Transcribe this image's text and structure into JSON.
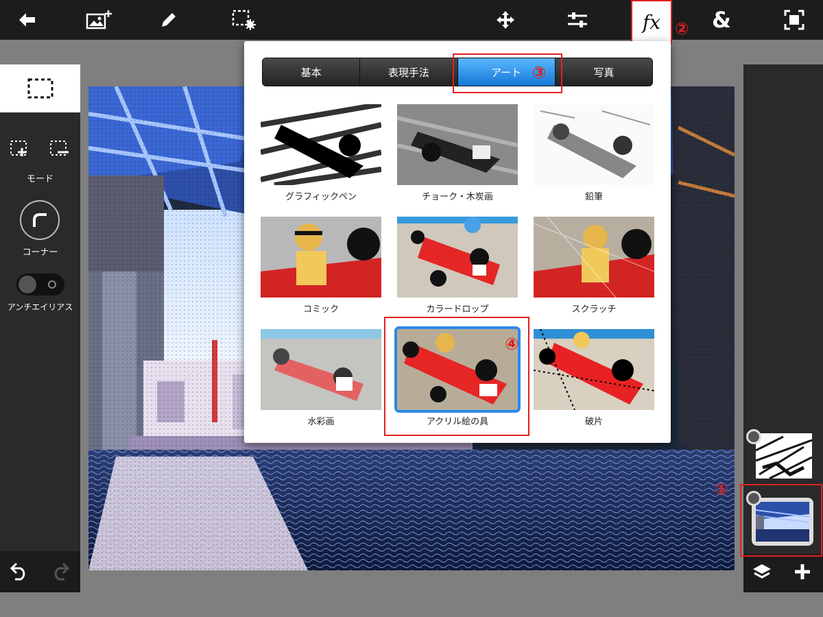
{
  "toolbar": {
    "items": [
      {
        "name": "back-button",
        "icon": "arrow-left-icon"
      },
      {
        "name": "add-image-button",
        "icon": "image-plus-icon"
      },
      {
        "name": "pencil-button",
        "icon": "pencil-icon"
      },
      {
        "name": "selection-settings-button",
        "icon": "selection-gear-icon"
      },
      {
        "name": "move-button",
        "icon": "move-arrows-icon"
      },
      {
        "name": "adjustments-button",
        "icon": "sliders-icon"
      },
      {
        "name": "effects-button",
        "icon": "fx-icon",
        "label": "fx"
      },
      {
        "name": "blend-button",
        "icon": "ampersand-icon",
        "label": "&"
      },
      {
        "name": "fit-screen-button",
        "icon": "fit-screen-icon"
      }
    ]
  },
  "left_panel": {
    "mode_label": "モード",
    "corner_label": "コーナー",
    "antialias_label": "アンチエイリアス"
  },
  "fx_popup": {
    "tabs": [
      {
        "label": "基本",
        "active": false
      },
      {
        "label": "表現手法",
        "active": false
      },
      {
        "label": "アート",
        "active": true
      },
      {
        "label": "写真",
        "active": false
      }
    ],
    "effects": [
      {
        "label": "グラフィックペン",
        "style": "graphic-pen"
      },
      {
        "label": "チョーク・木炭画",
        "style": "chalk"
      },
      {
        "label": "鉛筆",
        "style": "pencil"
      },
      {
        "label": "コミック",
        "style": "comic"
      },
      {
        "label": "カラードロップ",
        "style": "color-drop"
      },
      {
        "label": "スクラッチ",
        "style": "scratch"
      },
      {
        "label": "水彩画",
        "style": "watercolor"
      },
      {
        "label": "アクリル絵の具",
        "style": "acrylic",
        "selected": true
      },
      {
        "label": "破片",
        "style": "fragments"
      }
    ]
  },
  "callouts": [
    "①",
    "②",
    "③",
    "④"
  ],
  "colors": {
    "toolbar_bg": "#1c1c1c",
    "panel_bg": "#2a2a2a",
    "workspace_bg": "#7f7f7f",
    "accent_blue": "#1e88e5",
    "annotation_red": "#e02020"
  }
}
